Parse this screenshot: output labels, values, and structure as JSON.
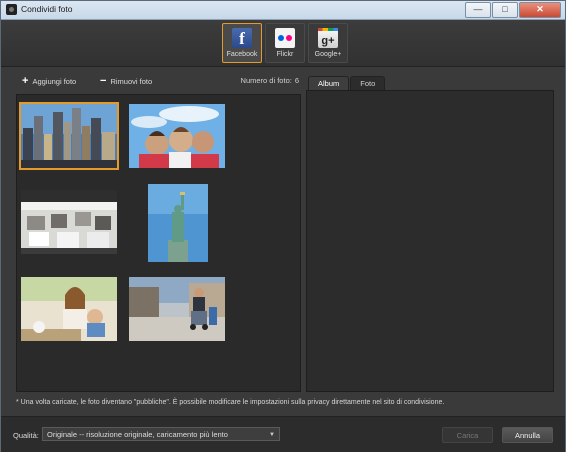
{
  "window": {
    "title": "Condividi foto",
    "controls": {
      "minimize": "—",
      "maximize": "□",
      "close": "✕"
    }
  },
  "services": [
    {
      "label": "Facebook",
      "icon": "facebook-icon",
      "active": true
    },
    {
      "label": "Flickr",
      "icon": "flickr-icon",
      "active": false
    },
    {
      "label": "Google+",
      "icon": "google-plus-icon",
      "active": false
    }
  ],
  "toolbar": {
    "add_label": "Aggiungi foto",
    "remove_label": "Rimuovi foto",
    "count_label": "Numero di foto:",
    "count_value": "6"
  },
  "photos": [
    {
      "name": "city-skyline",
      "selected": true
    },
    {
      "name": "friends-lying",
      "selected": false
    },
    {
      "name": "cafe-chairs",
      "selected": false
    },
    {
      "name": "statue-of-liberty",
      "selected": false
    },
    {
      "name": "woman-child-table",
      "selected": false
    },
    {
      "name": "mother-stroller",
      "selected": false
    }
  ],
  "tabs": [
    {
      "label": "Album",
      "active": true
    },
    {
      "label": "Foto",
      "active": false
    }
  ],
  "note": "* Una volta caricate, le foto diventano \"pubbliche\". È possibile modificare le impostazioni sulla privacy direttamente nel sito di condivisione.",
  "footer": {
    "quality_label": "Qualità:",
    "quality_value": "Originale -- risoluzione originale, caricamento più lento",
    "upload_label": "Carica",
    "cancel_label": "Annulla"
  },
  "colors": {
    "accent": "#e49b2c",
    "panel": "#2a2a2a"
  }
}
